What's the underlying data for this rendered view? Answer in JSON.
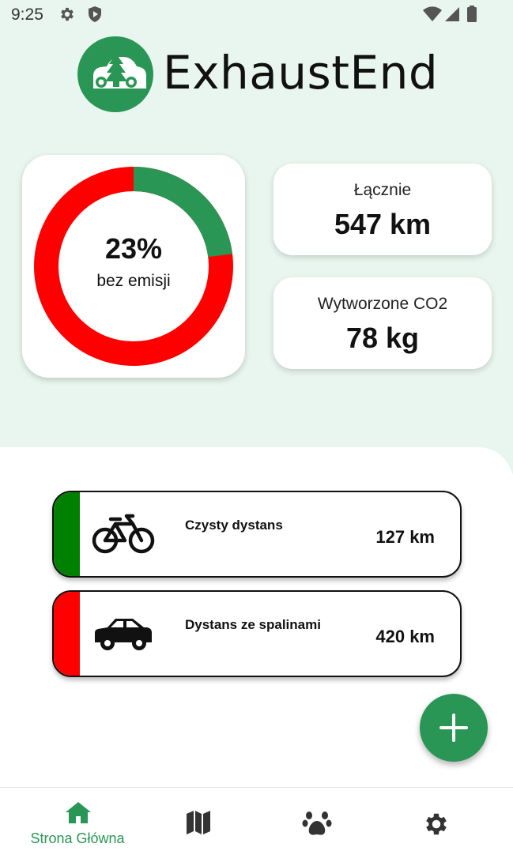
{
  "status_bar": {
    "time": "9:25",
    "icons": [
      "gear-icon",
      "shield-icon",
      "wifi-icon",
      "signal-icon",
      "battery-icon"
    ]
  },
  "header": {
    "app_name": "ExhaustEnd",
    "logo_icon": "car-tree-logo"
  },
  "summary": {
    "clean_percent": 0.23,
    "percent_label": "23%",
    "percent_caption": "bez emisji",
    "colors": {
      "clean": "#2a9655",
      "emission": "#ff0000"
    },
    "total": {
      "label": "Łącznie",
      "value": "547 km"
    },
    "co2": {
      "label": "Wytworzone CO2",
      "value": "78 kg"
    }
  },
  "trips": [
    {
      "icon": "bicycle-icon",
      "label": "Czysty dystans",
      "value": "127 km",
      "color": "#008000"
    },
    {
      "icon": "car-icon",
      "label": "Dystans ze spalinami",
      "value": "420 km",
      "color": "#ff0000"
    }
  ],
  "fab": {
    "icon": "plus-icon"
  },
  "nav": {
    "items": [
      {
        "icon": "home-icon",
        "label": "Strona Główna",
        "active": true
      },
      {
        "icon": "map-icon",
        "label": "",
        "active": false
      },
      {
        "icon": "paw-icon",
        "label": "",
        "active": false
      },
      {
        "icon": "gear-icon",
        "label": "",
        "active": false
      }
    ],
    "active_color": "#2a9655"
  }
}
